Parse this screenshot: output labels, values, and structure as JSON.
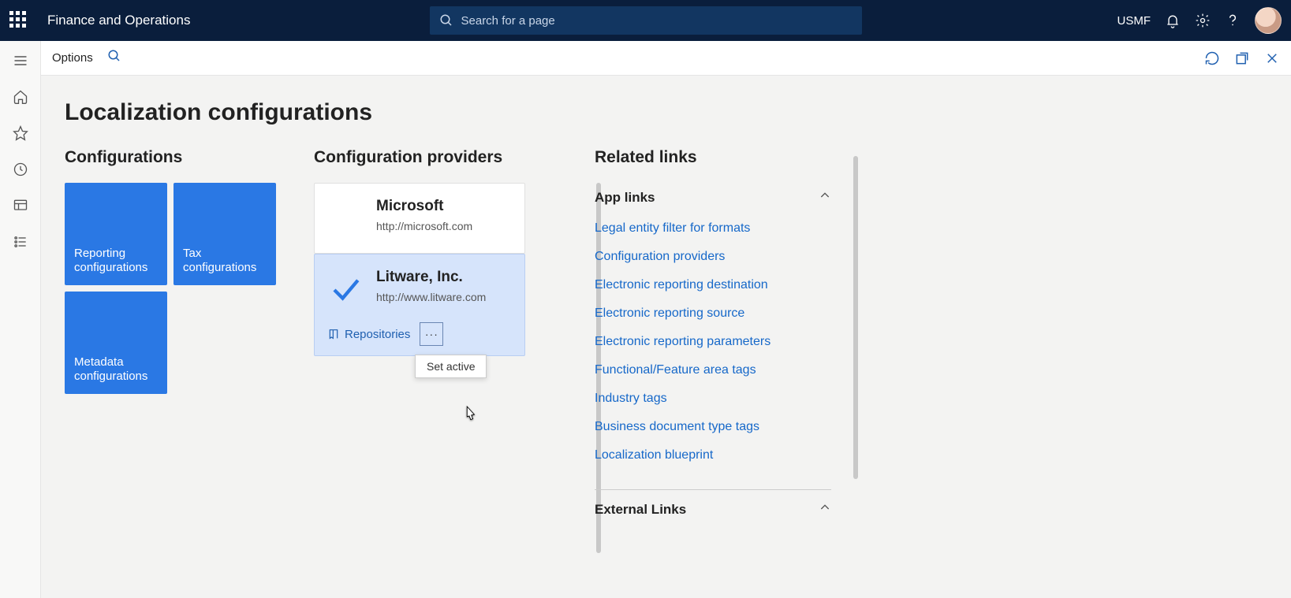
{
  "header": {
    "app_name": "Finance and Operations",
    "search_placeholder": "Search for a page",
    "company": "USMF"
  },
  "actionbar": {
    "options": "Options"
  },
  "page": {
    "title": "Localization configurations"
  },
  "configurations": {
    "title": "Configurations",
    "tiles": [
      {
        "line1": "Reporting",
        "line2": "configurations"
      },
      {
        "line1": "Tax",
        "line2": "configurations"
      },
      {
        "line1": "Metadata",
        "line2": "configurations"
      }
    ]
  },
  "providers": {
    "title": "Configuration providers",
    "cards": [
      {
        "name": "Microsoft",
        "url": "http://microsoft.com",
        "active": false
      },
      {
        "name": "Litware, Inc.",
        "url": "http://www.litware.com",
        "active": true
      }
    ],
    "repo_label": "Repositories",
    "menu_item": "Set active"
  },
  "related": {
    "title": "Related links",
    "group1": {
      "title": "App links",
      "links": [
        "Legal entity filter for formats",
        "Configuration providers",
        "Electronic reporting destination",
        "Electronic reporting source",
        "Electronic reporting parameters",
        "Functional/Feature area tags",
        "Industry tags",
        "Business document type tags",
        "Localization blueprint"
      ]
    },
    "group2": {
      "title": "External Links"
    }
  }
}
